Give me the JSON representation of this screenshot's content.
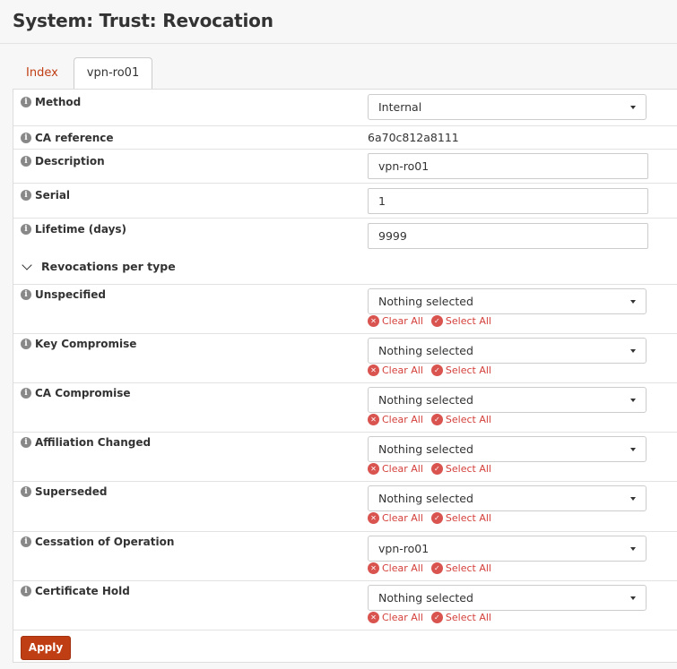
{
  "page": {
    "title": "System: Trust: Revocation"
  },
  "tabs": [
    {
      "label": "Index"
    },
    {
      "label": "vpn-ro01"
    }
  ],
  "fields": {
    "method": {
      "label": "Method",
      "value": "Internal"
    },
    "ca_reference": {
      "label": "CA reference",
      "value": "6a70c812a8111"
    },
    "description": {
      "label": "Description",
      "value": "vpn-ro01"
    },
    "serial": {
      "label": "Serial",
      "value": "1"
    },
    "lifetime": {
      "label": "Lifetime (days)",
      "value": "9999"
    }
  },
  "section": {
    "label": "Revocations per type"
  },
  "revocations": [
    {
      "label": "Unspecified",
      "value": "Nothing selected"
    },
    {
      "label": "Key Compromise",
      "value": "Nothing selected"
    },
    {
      "label": "CA Compromise",
      "value": "Nothing selected"
    },
    {
      "label": "Affiliation Changed",
      "value": "Nothing selected"
    },
    {
      "label": "Superseded",
      "value": "Nothing selected"
    },
    {
      "label": "Cessation of Operation",
      "value": "vpn-ro01"
    },
    {
      "label": "Certificate Hold",
      "value": "Nothing selected"
    }
  ],
  "actions": {
    "clear_all": "Clear All",
    "select_all": "Select All"
  },
  "buttons": {
    "apply": "Apply"
  },
  "icons": {
    "info": "info-icon",
    "clear": "clear-icon",
    "select": "check-icon"
  },
  "colors": {
    "accent": "#c03e14",
    "danger": "#d9534f"
  }
}
